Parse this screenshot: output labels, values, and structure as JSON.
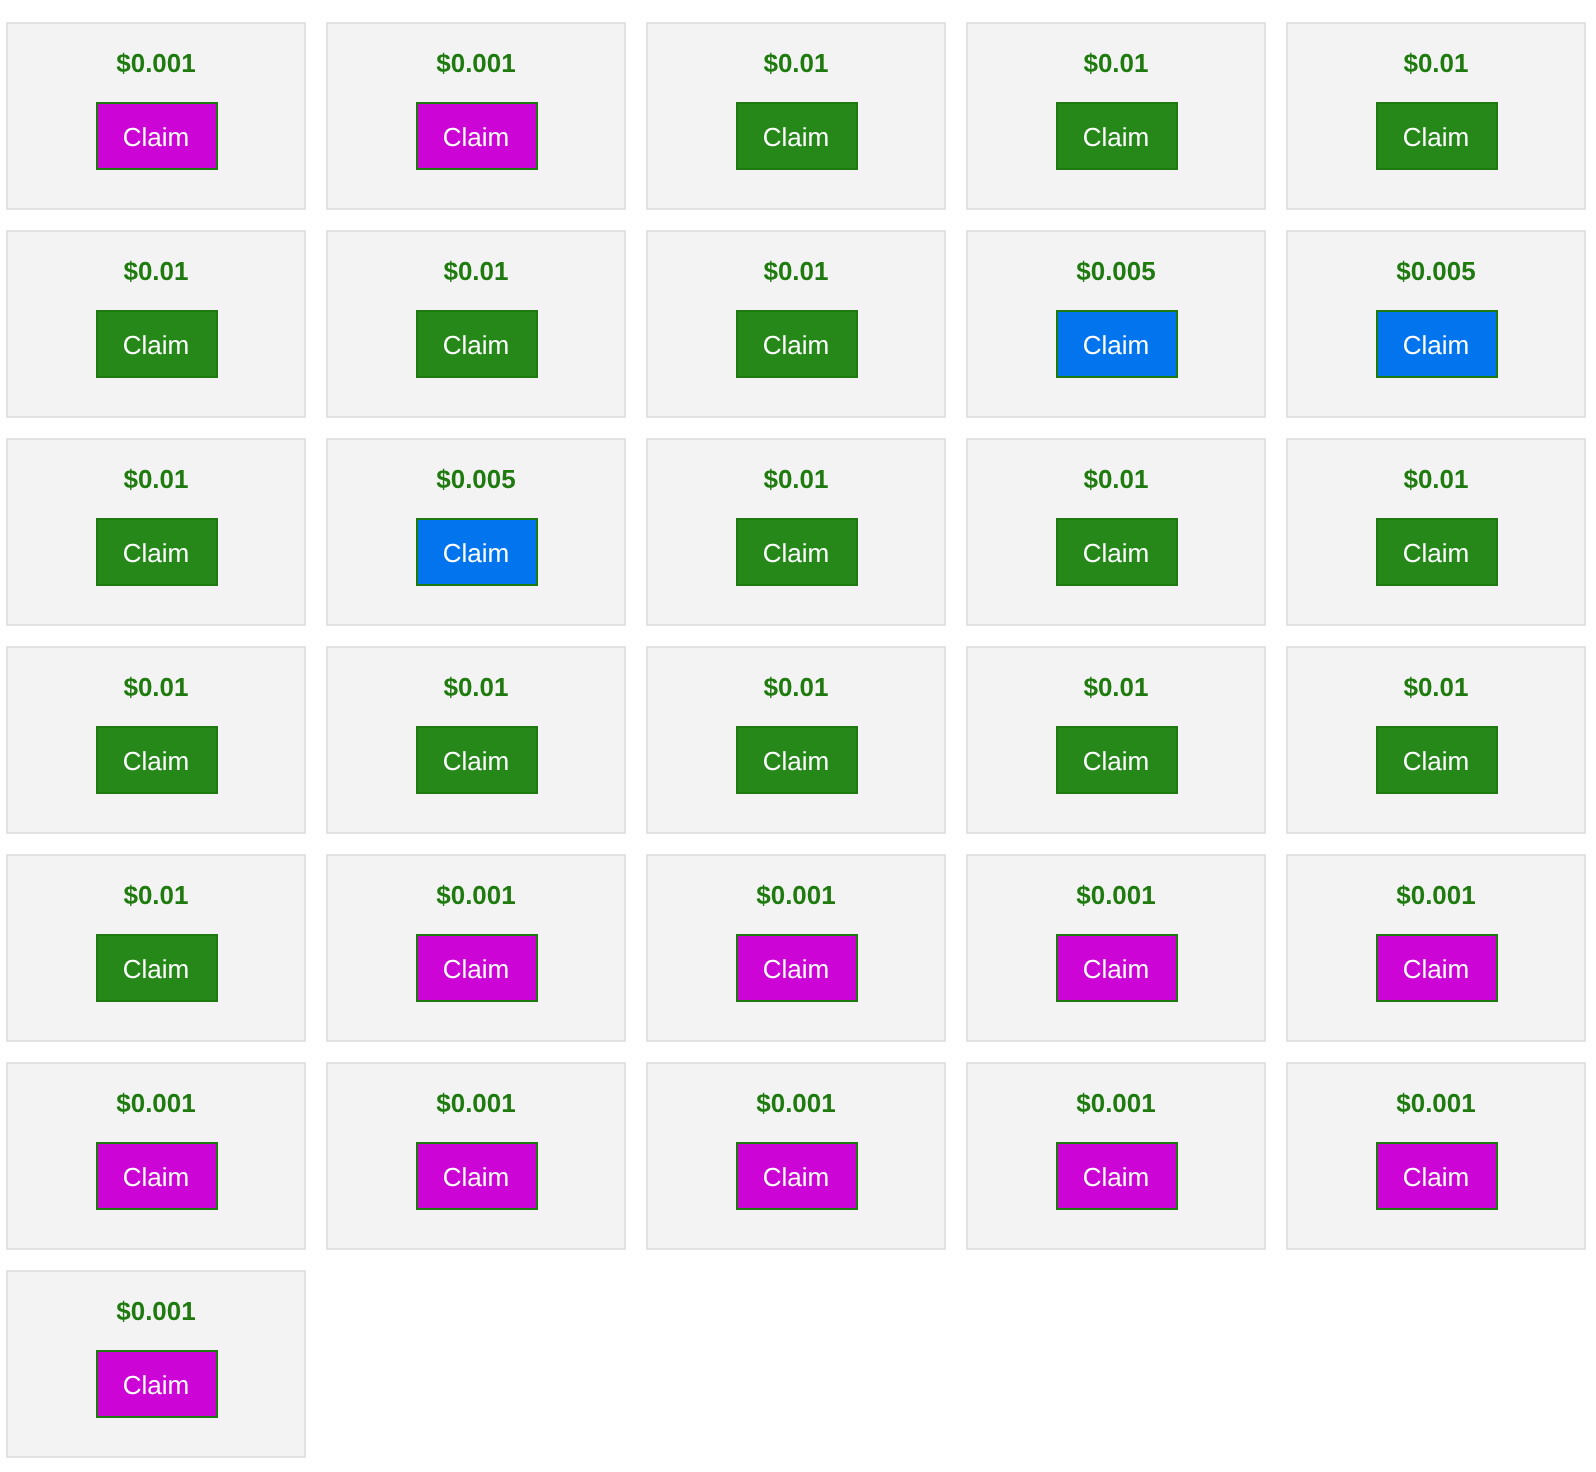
{
  "cards": [
    {
      "amount": "$0.001",
      "button": "Claim",
      "color": "#cc04d6"
    },
    {
      "amount": "$0.001",
      "button": "Claim",
      "color": "#cc04d6"
    },
    {
      "amount": "$0.01",
      "button": "Claim",
      "color": "#268818"
    },
    {
      "amount": "$0.01",
      "button": "Claim",
      "color": "#268818"
    },
    {
      "amount": "$0.01",
      "button": "Claim",
      "color": "#268818"
    },
    {
      "amount": "$0.01",
      "button": "Claim",
      "color": "#268818"
    },
    {
      "amount": "$0.01",
      "button": "Claim",
      "color": "#268818"
    },
    {
      "amount": "$0.01",
      "button": "Claim",
      "color": "#268818"
    },
    {
      "amount": "$0.005",
      "button": "Claim",
      "color": "#0275ee"
    },
    {
      "amount": "$0.005",
      "button": "Claim",
      "color": "#0275ee"
    },
    {
      "amount": "$0.01",
      "button": "Claim",
      "color": "#268818"
    },
    {
      "amount": "$0.005",
      "button": "Claim",
      "color": "#0275ee"
    },
    {
      "amount": "$0.01",
      "button": "Claim",
      "color": "#268818"
    },
    {
      "amount": "$0.01",
      "button": "Claim",
      "color": "#268818"
    },
    {
      "amount": "$0.01",
      "button": "Claim",
      "color": "#268818"
    },
    {
      "amount": "$0.01",
      "button": "Claim",
      "color": "#268818"
    },
    {
      "amount": "$0.01",
      "button": "Claim",
      "color": "#268818"
    },
    {
      "amount": "$0.01",
      "button": "Claim",
      "color": "#268818"
    },
    {
      "amount": "$0.01",
      "button": "Claim",
      "color": "#268818"
    },
    {
      "amount": "$0.01",
      "button": "Claim",
      "color": "#268818"
    },
    {
      "amount": "$0.01",
      "button": "Claim",
      "color": "#268818"
    },
    {
      "amount": "$0.001",
      "button": "Claim",
      "color": "#cc04d6"
    },
    {
      "amount": "$0.001",
      "button": "Claim",
      "color": "#cc04d6"
    },
    {
      "amount": "$0.001",
      "button": "Claim",
      "color": "#cc04d6"
    },
    {
      "amount": "$0.001",
      "button": "Claim",
      "color": "#cc04d6"
    },
    {
      "amount": "$0.001",
      "button": "Claim",
      "color": "#cc04d6"
    },
    {
      "amount": "$0.001",
      "button": "Claim",
      "color": "#cc04d6"
    },
    {
      "amount": "$0.001",
      "button": "Claim",
      "color": "#cc04d6"
    },
    {
      "amount": "$0.001",
      "button": "Claim",
      "color": "#cc04d6"
    },
    {
      "amount": "$0.001",
      "button": "Claim",
      "color": "#cc04d6"
    },
    {
      "amount": "$0.001",
      "button": "Claim",
      "color": "#cc04d6"
    }
  ]
}
